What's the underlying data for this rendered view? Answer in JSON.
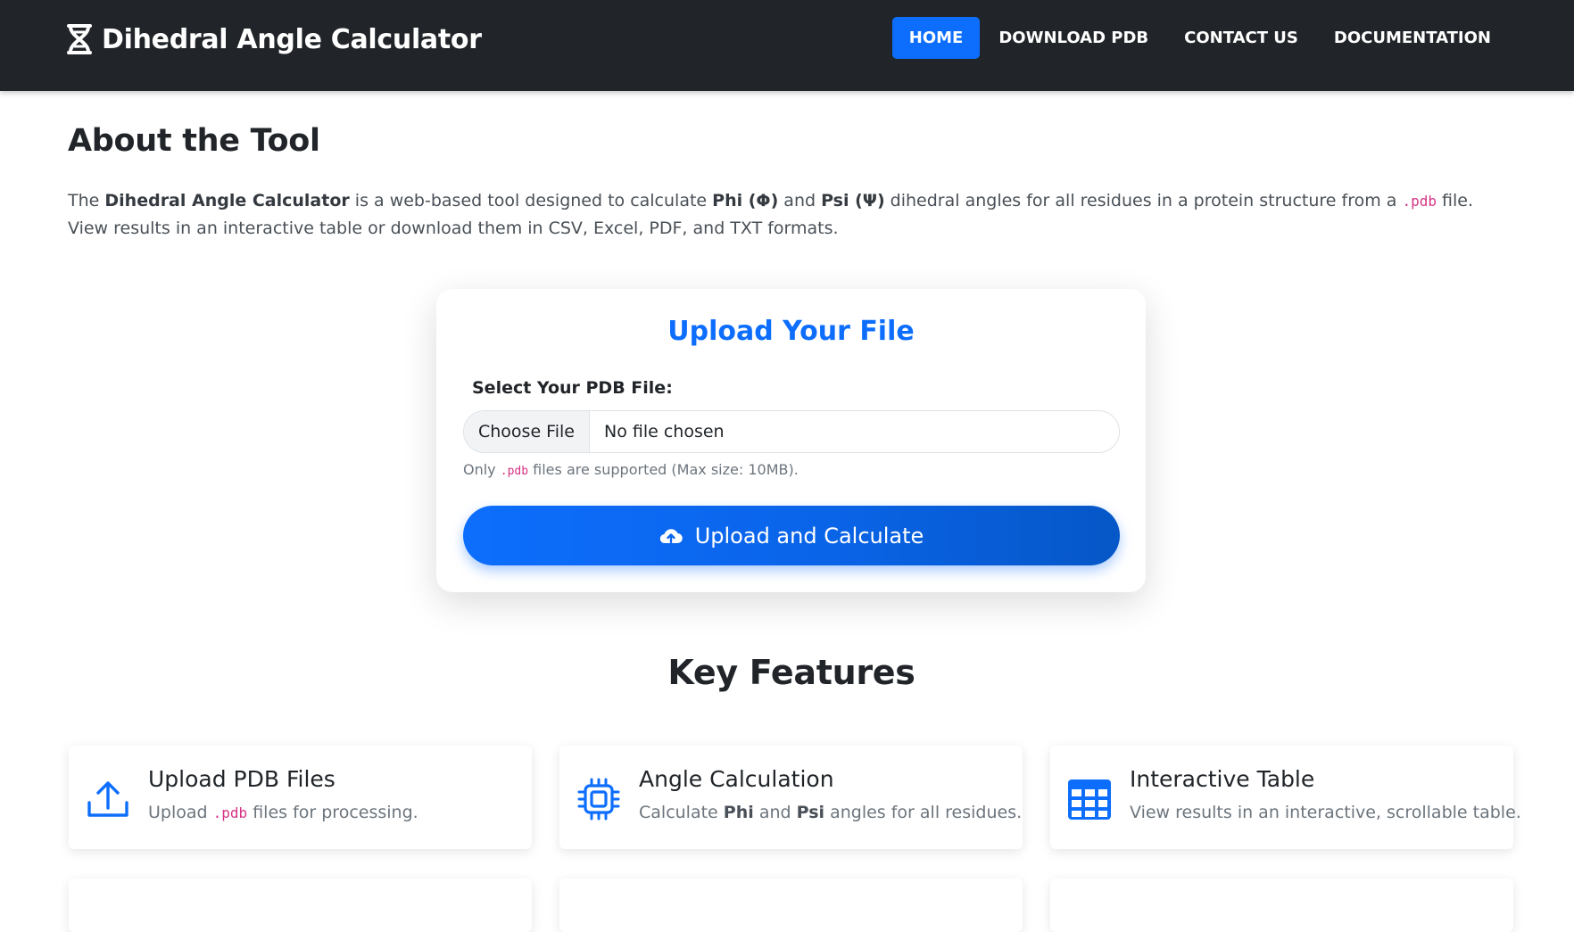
{
  "brand": {
    "title": "Dihedral Angle Calculator",
    "icon": "dna-icon"
  },
  "nav": {
    "items": [
      {
        "label": "HOME",
        "active": true
      },
      {
        "label": "DOWNLOAD PDB",
        "active": false
      },
      {
        "label": "CONTACT US",
        "active": false
      },
      {
        "label": "DOCUMENTATION",
        "active": false
      }
    ]
  },
  "about": {
    "title": "About the Tool",
    "p_the": "The",
    "p_name": "Dihedral Angle Calculator",
    "p_mid1": " is a web-based tool designed to calculate ",
    "p_phi": "Phi (Φ)",
    "p_and": " and ",
    "p_psi": "Psi (Ψ)",
    "p_mid2": " dihedral angles for all residues in a protein structure from a ",
    "p_ext": ".pdb",
    "p_end": " file. View results in an interactive table or download them in CSV, Excel, PDF, and TXT formats."
  },
  "upload": {
    "title": "Upload Your File",
    "label": "Select Your PDB File:",
    "choose_button": "Choose File",
    "file_status": "No file chosen",
    "help_pre": "Only",
    "help_ext": ".pdb",
    "help_post": "files are supported (Max size: 10MB).",
    "submit_label": "Upload and Calculate",
    "submit_icon": "cloud-upload-icon"
  },
  "features": {
    "title": "Key Features",
    "items": [
      {
        "title": "Upload PDB Files",
        "icon": "upload-icon",
        "desc_pre": "Upload",
        "desc_code": ".pdb",
        "desc_post": "files for processing."
      },
      {
        "title": "Angle Calculation",
        "icon": "cpu-icon",
        "desc_pre": "Calculate",
        "desc_b1": "Phi",
        "desc_mid": "and",
        "desc_b2": "Psi",
        "desc_post": "angles for all residues."
      },
      {
        "title": "Interactive Table",
        "icon": "table-icon",
        "desc": "View results in an interactive, scrollable table."
      }
    ]
  },
  "colors": {
    "navbar_bg": "#212529",
    "accent": "#0d6efd",
    "code": "#d63384"
  }
}
